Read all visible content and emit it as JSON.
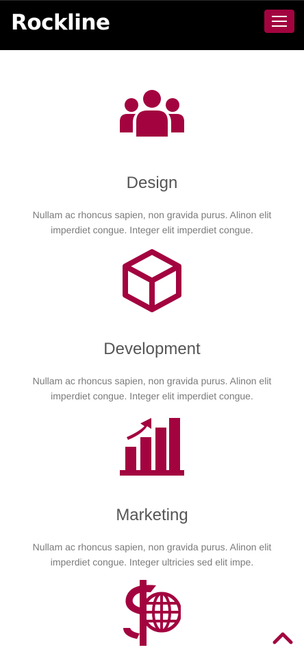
{
  "header": {
    "brand": "Rockline",
    "menu_icon": "hamburger-menu-icon"
  },
  "colors": {
    "accent": "#a3043f",
    "header_bg": "#000000",
    "heading_text": "#555555",
    "body_text": "#7a7a7a"
  },
  "services": [
    {
      "icon": "users-group-icon",
      "title": "Design",
      "text": "Nullam ac rhoncus sapien, non gravida purus. Alinon elit imperdiet congue. Integer elit imperdiet congue."
    },
    {
      "icon": "cube-icon",
      "title": "Development",
      "text": "Nullam ac rhoncus sapien, non gravida purus. Alinon elit imperdiet congue. Integer elit imperdiet congue."
    },
    {
      "icon": "bar-chart-growth-icon",
      "title": "Marketing",
      "text": "Nullam ac rhoncus sapien, non gravida purus. Alinon elit imperdiet congue. Integer ultricies sed elit impe."
    },
    {
      "icon": "dollar-globe-icon"
    }
  ],
  "scroll_top_icon": "chevron-up-icon"
}
